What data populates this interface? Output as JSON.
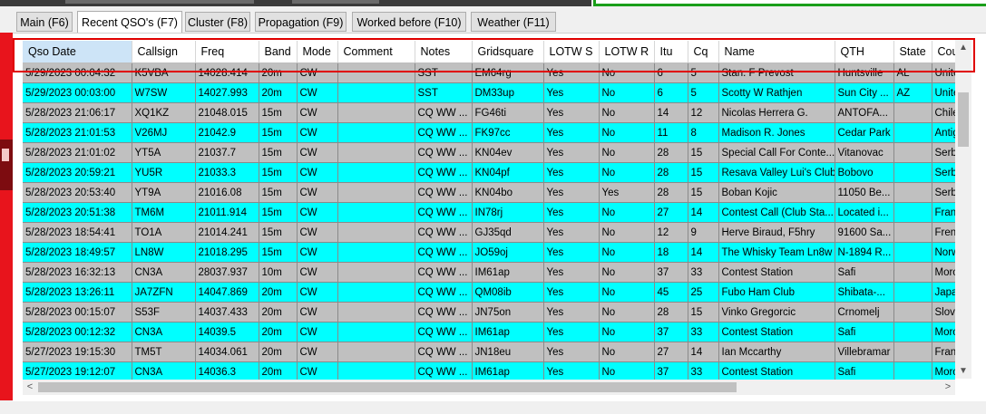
{
  "tabs": [
    {
      "label": "Main (F6)",
      "active": false
    },
    {
      "label": "Recent QSO's (F7)",
      "active": true
    },
    {
      "label": "Cluster (F8)",
      "active": false
    },
    {
      "label": "Propagation (F9)",
      "active": false
    },
    {
      "label": "Worked before (F10)",
      "active": false
    },
    {
      "label": "Weather (F11)",
      "active": false
    }
  ],
  "grid": {
    "columns": [
      "Qso Date",
      "Callsign",
      "Freq",
      "Band",
      "Mode",
      "Comment",
      "Notes",
      "Gridsquare",
      "LOTW S",
      "LOTW R",
      "Itu",
      "Cq",
      "Name",
      "QTH",
      "State",
      "Country"
    ],
    "sorted_column": "Qso Date",
    "rows": [
      {
        "style": "gray",
        "cells": [
          "5/29/2023 00:04:32",
          "K5VBA",
          "14028.414",
          "20m",
          "CW",
          "",
          "SST",
          "EM64rg",
          "Yes",
          "No",
          "6",
          "5",
          "Stan. F Prevost",
          "Huntsville",
          "AL",
          "United"
        ]
      },
      {
        "style": "cyan",
        "cells": [
          "5/29/2023 00:03:00",
          "W7SW",
          "14027.993",
          "20m",
          "CW",
          "",
          "SST",
          "DM33up",
          "Yes",
          "No",
          "6",
          "5",
          "Scotty W Rathjen",
          "Sun City ...",
          "AZ",
          "United"
        ]
      },
      {
        "style": "gray",
        "cells": [
          "5/28/2023 21:06:17",
          "XQ1KZ",
          "21048.015",
          "15m",
          "CW",
          "",
          "CQ WW ...",
          "FG46ti",
          "Yes",
          "No",
          "14",
          "12",
          "Nicolas Herrera G.",
          "ANTOFA...",
          "",
          "Chile"
        ]
      },
      {
        "style": "cyan",
        "cells": [
          "5/28/2023 21:01:53",
          "V26MJ",
          "21042.9",
          "15m",
          "CW",
          "",
          "CQ WW ...",
          "FK97cc",
          "Yes",
          "No",
          "11",
          "8",
          "Madison R. Jones",
          "Cedar Park",
          "",
          "Antigu"
        ]
      },
      {
        "style": "gray",
        "cells": [
          "5/28/2023 21:01:02",
          "YT5A",
          "21037.7",
          "15m",
          "CW",
          "",
          "CQ WW ...",
          "KN04ev",
          "Yes",
          "No",
          "28",
          "15",
          "Special Call For Conte...",
          "Vitanovac",
          "",
          "Serbia"
        ]
      },
      {
        "style": "cyan",
        "cells": [
          "5/28/2023 20:59:21",
          "YU5R",
          "21033.3",
          "15m",
          "CW",
          "",
          "CQ WW ...",
          "KN04pf",
          "Yes",
          "No",
          "28",
          "15",
          "Resava Valley Lui's Club",
          "Bobovo",
          "",
          "Serbia"
        ]
      },
      {
        "style": "gray",
        "cells": [
          "5/28/2023 20:53:40",
          "YT9A",
          "21016.08",
          "15m",
          "CW",
          "",
          "CQ WW ...",
          "KN04bo",
          "Yes",
          "Yes",
          "28",
          "15",
          "Boban Kojic",
          "11050 Be...",
          "",
          "Serbia"
        ]
      },
      {
        "style": "cyan",
        "cells": [
          "5/28/2023 20:51:38",
          "TM6M",
          "21011.914",
          "15m",
          "CW",
          "",
          "CQ WW ...",
          "IN78rj",
          "Yes",
          "No",
          "27",
          "14",
          "Contest Call (Club Sta...",
          "Located i...",
          "",
          "France"
        ]
      },
      {
        "style": "gray",
        "cells": [
          "5/28/2023 18:54:41",
          "TO1A",
          "21014.241",
          "15m",
          "CW",
          "",
          "CQ WW ...",
          "GJ35qd",
          "Yes",
          "No",
          "12",
          "9",
          "Herve Biraud, F5hry",
          "91600 Sa...",
          "",
          "French"
        ]
      },
      {
        "style": "cyan",
        "cells": [
          "5/28/2023 18:49:57",
          "LN8W",
          "21018.295",
          "15m",
          "CW",
          "",
          "CQ WW ...",
          "JO59oj",
          "Yes",
          "No",
          "18",
          "14",
          "The Whisky Team Ln8w",
          "N-1894 R...",
          "",
          "Norwa"
        ]
      },
      {
        "style": "gray",
        "cells": [
          "5/28/2023 16:32:13",
          "CN3A",
          "28037.937",
          "10m",
          "CW",
          "",
          "CQ WW ...",
          "IM61ap",
          "Yes",
          "No",
          "37",
          "33",
          "Contest Station",
          "Safi",
          "",
          "Moroc"
        ]
      },
      {
        "style": "cyan",
        "cells": [
          "5/28/2023 13:26:11",
          "JA7ZFN",
          "14047.869",
          "20m",
          "CW",
          "",
          "CQ WW ...",
          "QM08ib",
          "Yes",
          "No",
          "45",
          "25",
          "Fubo Ham Club",
          "Shibata-...",
          "",
          "Japan"
        ]
      },
      {
        "style": "gray",
        "cells": [
          "5/28/2023 00:15:07",
          "S53F",
          "14037.433",
          "20m",
          "CW",
          "",
          "CQ WW ...",
          "JN75on",
          "Yes",
          "No",
          "28",
          "15",
          "Vinko Gregorcic",
          "Crnomelj",
          "",
          "Sloven"
        ]
      },
      {
        "style": "cyan",
        "cells": [
          "5/28/2023 00:12:32",
          "CN3A",
          "14039.5",
          "20m",
          "CW",
          "",
          "CQ WW ...",
          "IM61ap",
          "Yes",
          "No",
          "37",
          "33",
          "Contest Station",
          "Safi",
          "",
          "Moroc"
        ]
      },
      {
        "style": "gray",
        "cells": [
          "5/27/2023 19:15:30",
          "TM5T",
          "14034.061",
          "20m",
          "CW",
          "",
          "CQ WW ...",
          "JN18eu",
          "Yes",
          "No",
          "27",
          "14",
          "Ian Mccarthy",
          "Villebramar",
          "",
          "France"
        ]
      },
      {
        "style": "cyan",
        "cells": [
          "5/27/2023 19:12:07",
          "CN3A",
          "14036.3",
          "20m",
          "CW",
          "",
          "CQ WW ...",
          "IM61ap",
          "Yes",
          "No",
          "37",
          "33",
          "Contest Station",
          "Safi",
          "",
          "Moroc"
        ]
      }
    ]
  },
  "colors": {
    "row_cyan": "#00ffff",
    "row_gray": "#c0c0c0",
    "highlight": "#e00000",
    "left_strip": "#e8141c"
  },
  "scrollbar_icons": {
    "up": "chevron-up-icon",
    "down": "chevron-down-icon",
    "left": "chevron-left-icon",
    "right": "chevron-right-icon"
  }
}
